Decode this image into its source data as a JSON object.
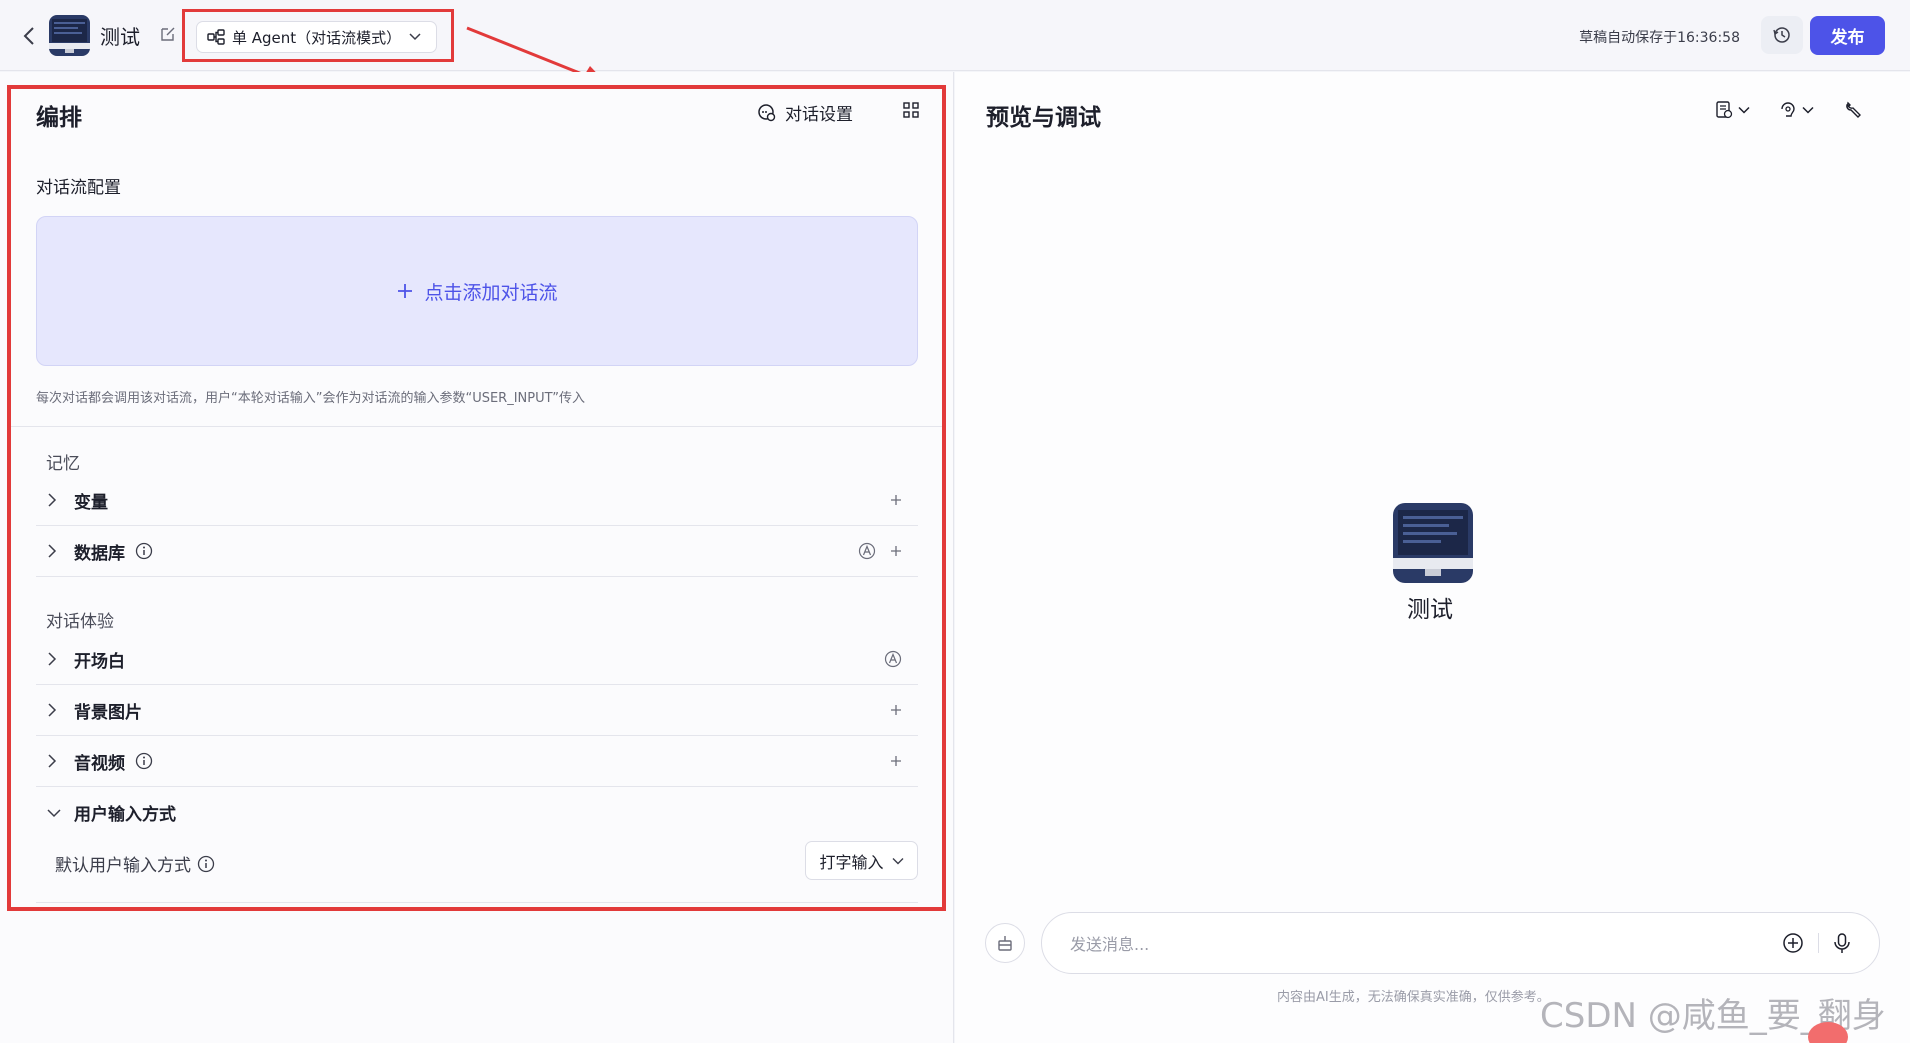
{
  "header": {
    "app_name": "测试",
    "mode_label": "单 Agent（对话流模式）",
    "autosave": "草稿自动保存于16:36:58",
    "publish_label": "发布"
  },
  "orchestration": {
    "title": "编排",
    "dialog_settings_label": "对话设置",
    "flow_config_title": "对话流配置",
    "add_flow_label": "点击添加对话流",
    "hint": "每次对话都会调用该对话流，用户“本轮对话输入”会作为对话流的输入参数“USER_INPUT”传入",
    "memory_group": "记忆",
    "variables_label": "变量",
    "database_label": "数据库",
    "experience_group": "对话体验",
    "opening_label": "开场白",
    "background_label": "背景图片",
    "audio_video_label": "音视频",
    "user_input_label": "用户输入方式",
    "default_input_label": "默认用户输入方式",
    "default_input_value": "打字输入"
  },
  "preview": {
    "title": "预览与调试",
    "bot_name": "测试",
    "message_placeholder": "发送消息...",
    "disclaimer": "内容由AI生成，无法确保真实准确，仅供参考。",
    "watermark": "CSDN @咸鱼_要_翻身"
  },
  "colors": {
    "accent": "#4d53e8",
    "annotation_red": "#e23a3a",
    "add_flow_bg": "#e6e7fd"
  }
}
